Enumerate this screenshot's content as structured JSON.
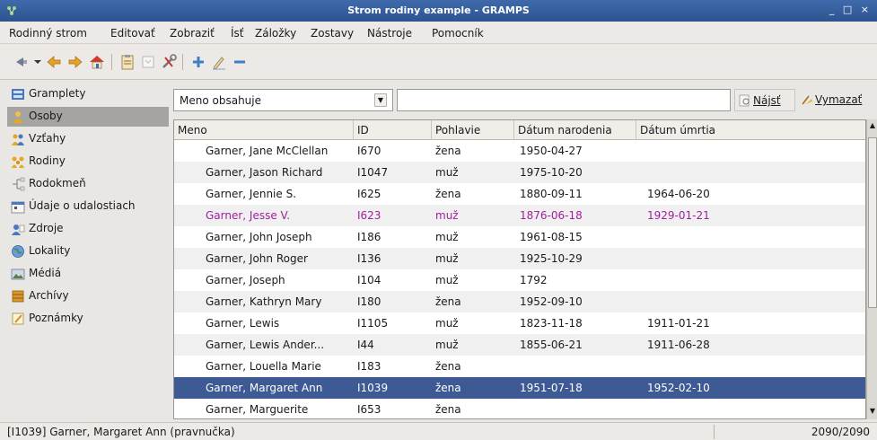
{
  "window": {
    "title": "Strom rodiny example - GRAMPS",
    "controls": "_ □ ×"
  },
  "menu": [
    "Rodinný strom",
    "Editovať",
    "Zobraziť",
    "Ísť",
    "Záložky",
    "Zostavy",
    "Nástroje",
    "Pomocník"
  ],
  "sidebar": {
    "items": [
      {
        "label": "Gramplety",
        "icon": "gramplets-icon"
      },
      {
        "label": "Osoby",
        "icon": "people-icon",
        "active": true
      },
      {
        "label": "Vzťahy",
        "icon": "relationships-icon"
      },
      {
        "label": "Rodiny",
        "icon": "families-icon"
      },
      {
        "label": "Rodokmeň",
        "icon": "pedigree-icon"
      },
      {
        "label": "Údaje o udalostiach",
        "icon": "events-icon"
      },
      {
        "label": "Zdroje",
        "icon": "sources-icon"
      },
      {
        "label": "Lokality",
        "icon": "places-icon"
      },
      {
        "label": "Médiá",
        "icon": "media-icon"
      },
      {
        "label": "Archívy",
        "icon": "repositories-icon"
      },
      {
        "label": "Poznámky",
        "icon": "notes-icon"
      }
    ]
  },
  "filter": {
    "selected": "Meno obsahuje",
    "search_value": "",
    "find_label": "Nájsť",
    "clear_label": "Vymazať"
  },
  "table": {
    "columns": [
      "Meno",
      "ID",
      "Pohlavie",
      "Dátum narodenia",
      "Dátum úmrtia"
    ],
    "rows": [
      {
        "name": "Garner, Jane McClellan",
        "id": "I670",
        "gender": "žena",
        "birth": "1950-04-27",
        "death": ""
      },
      {
        "name": "Garner, Jason Richard",
        "id": "I1047",
        "gender": "muž",
        "birth": "1975-10-20",
        "death": ""
      },
      {
        "name": "Garner, Jennie S.",
        "id": "I625",
        "gender": "žena",
        "birth": "1880-09-11",
        "death": "1964-06-20"
      },
      {
        "name": "Garner, Jesse V.",
        "id": "I623",
        "gender": "muž",
        "birth": "1876-06-18",
        "death": "1929-01-21",
        "highlight": true
      },
      {
        "name": "Garner, John Joseph",
        "id": "I186",
        "gender": "muž",
        "birth": "1961-08-15",
        "death": ""
      },
      {
        "name": "Garner, John Roger",
        "id": "I136",
        "gender": "muž",
        "birth": "1925-10-29",
        "death": ""
      },
      {
        "name": "Garner, Joseph",
        "id": "I104",
        "gender": "muž",
        "birth": "1792",
        "death": ""
      },
      {
        "name": "Garner, Kathryn Mary",
        "id": "I180",
        "gender": "žena",
        "birth": "1952-09-10",
        "death": ""
      },
      {
        "name": "Garner, Lewis",
        "id": "I1105",
        "gender": "muž",
        "birth": "1823-11-18",
        "death": "1911-01-21"
      },
      {
        "name": "Garner, Lewis Ander...",
        "id": "I44",
        "gender": "muž",
        "birth": "1855-06-21",
        "death": "1911-06-28"
      },
      {
        "name": "Garner, Louella Marie",
        "id": "I183",
        "gender": "žena",
        "birth": "",
        "death": ""
      },
      {
        "name": "Garner, Margaret Ann",
        "id": "I1039",
        "gender": "žena",
        "birth": "1951-07-18",
        "death": "1952-02-10",
        "selected": true
      },
      {
        "name": "Garner, Marguerite",
        "id": "I653",
        "gender": "žena",
        "birth": "",
        "death": ""
      }
    ]
  },
  "status": {
    "text": "[I1039] Garner, Margaret Ann (pravnučka)",
    "count": "2090/2090"
  },
  "colors": {
    "selection": "#3d5a94",
    "highlight_text": "#a020a0",
    "titlebar": "#2e5390"
  }
}
